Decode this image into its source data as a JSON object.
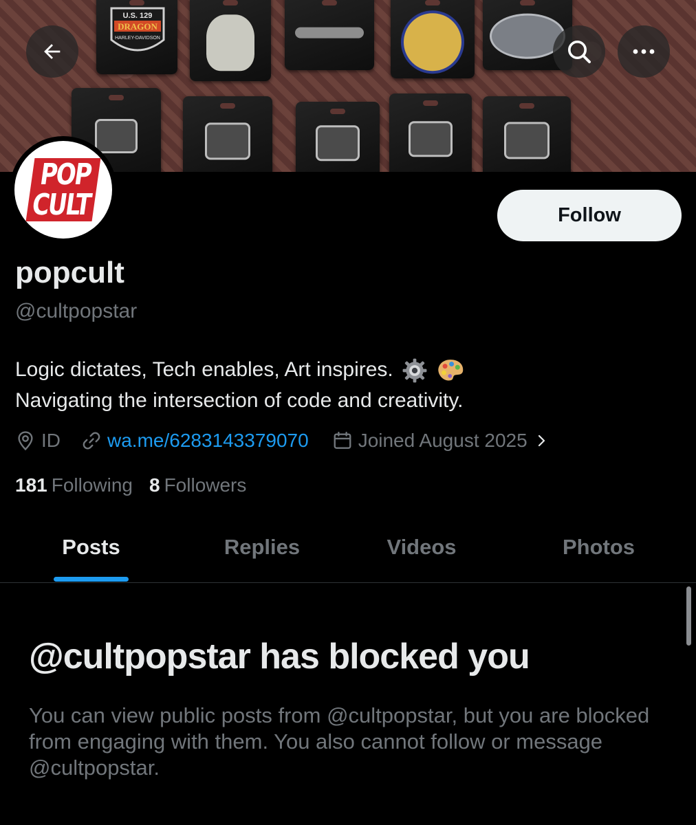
{
  "nav": {
    "back_icon": "arrow-left-icon",
    "search_icon": "search-icon",
    "more_icon": "more-horizontal-icon"
  },
  "banner": {
    "pin_texts": [
      "U.S. 129",
      "DRAGON",
      "HARLEY-DAVIDSON"
    ]
  },
  "avatar": {
    "logo_line1": "POP",
    "logo_line2": "CULT",
    "logo_color": "#d0242b"
  },
  "profile": {
    "follow_label": "Follow",
    "display_name": "popcult",
    "handle": "@cultpopstar",
    "bio_line1": "Logic dictates, Tech enables, Art inspires.",
    "bio_line2": "Navigating the intersection of code and creativity.",
    "location": "ID",
    "link": "wa.me/6283143379070",
    "joined": "Joined August 2025",
    "following_count": "181",
    "following_label": "Following",
    "followers_count": "8",
    "followers_label": "Followers"
  },
  "tabs": [
    {
      "label": "Posts",
      "active": true
    },
    {
      "label": "Replies",
      "active": false
    },
    {
      "label": "Videos",
      "active": false
    },
    {
      "label": "Photos",
      "active": false
    }
  ],
  "blocked": {
    "title": "@cultpopstar has blocked you",
    "message": "You can view public posts from @cultpopstar, but you are blocked from engaging with them. You also cannot follow or message @cultpopstar."
  },
  "colors": {
    "accent": "#1d9bf0",
    "text_primary": "#e7e9ea",
    "text_secondary": "#71767b",
    "background": "#000000"
  }
}
